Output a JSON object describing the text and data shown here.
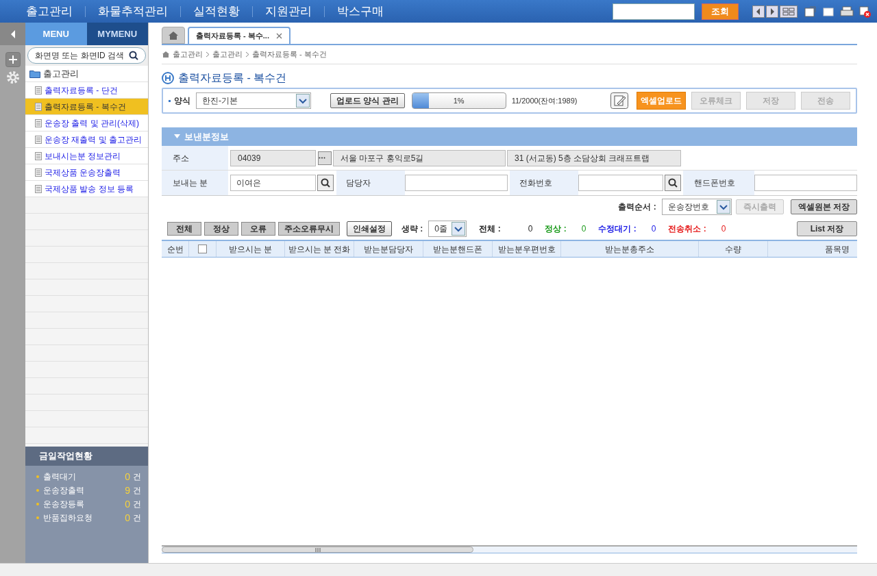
{
  "top_menu": [
    "출고관리",
    "화물추적관리",
    "실적현황",
    "지원관리",
    "박스구매"
  ],
  "top_search": {
    "button": "조회"
  },
  "side_tabs": [
    {
      "label": "MENU",
      "selected": true
    },
    {
      "label": "MYMENU",
      "selected": false
    }
  ],
  "side_search": {
    "placeholder": "화면명 또는 화면ID 검색"
  },
  "tree": {
    "label": "출고관리",
    "children": [
      {
        "label": "출력자료등록 - 단건",
        "selected": false
      },
      {
        "label": "출력자료등록 - 복수건",
        "selected": true
      },
      {
        "label": "운송장 출력 및 관리(삭제)",
        "selected": false
      },
      {
        "label": "운송장 재출력 및 출고관리",
        "selected": false
      },
      {
        "label": "보내시는분 정보관리",
        "selected": false
      },
      {
        "label": "국제상품 운송장출력",
        "selected": false
      },
      {
        "label": "국제상품 발송 정보 등록",
        "selected": false
      }
    ]
  },
  "today_status": {
    "title": "금일작업현황",
    "items": [
      {
        "label": "출력대기",
        "count": "0",
        "unit": "건"
      },
      {
        "label": "운송장출력",
        "count": "9",
        "unit": "건"
      },
      {
        "label": "운송장등록",
        "count": "0",
        "unit": "건"
      },
      {
        "label": "반품집하요청",
        "count": "0",
        "unit": "건"
      }
    ]
  },
  "tabs": [
    {
      "label": "출력자료등록 - 복수...",
      "selected": true
    }
  ],
  "breadcrumb": [
    "출고관리",
    "출고관리",
    "출력자료등록 - 복수건"
  ],
  "page_title": "출력자료등록 - 복수건",
  "toolbar": {
    "form_label": "양식",
    "form_value": "한진-기본",
    "manage_button": "업로드 양식 관리",
    "progress": {
      "level": 0.01,
      "reading": "1%"
    },
    "count": "11/2000(잔여:1989)",
    "buttons": [
      {
        "label": "엑셀업로드",
        "disabled": false
      },
      {
        "label": "오류체크",
        "disabled": true
      },
      {
        "label": "저장",
        "disabled": true
      },
      {
        "label": "전송",
        "disabled": true
      }
    ]
  },
  "sender": {
    "title": "보낸분정보",
    "address_label": "주소",
    "zip": "04039",
    "address1": "서울 마포구  홍익로5길",
    "address2": "31 (서교동) 5층 소담상회 크래프트랩",
    "name_label": "보내는 분",
    "name": "이여은",
    "contact_label": "담당자",
    "phone_label": "전화번호",
    "mobile_label": "핸드폰번호"
  },
  "output": {
    "order_label": "출력순서 :",
    "order_value": "운송장번호",
    "buttons": [
      {
        "label": "즉시출력",
        "disabled": true
      },
      {
        "label": "엑셀원본 저장",
        "disabled": false
      }
    ]
  },
  "filters": {
    "buttons": [
      "전체",
      "정상",
      "오류",
      "주소오류무시"
    ],
    "print_settings": "인쇄설정",
    "skip_label": "생략 :",
    "skip_value": "0줄",
    "summary": [
      {
        "label": "전체 :",
        "value": "0",
        "color": "#222222"
      },
      {
        "label": "정상 :",
        "value": "0",
        "color": "#1a9a1a"
      },
      {
        "label": "수정대기 :",
        "value": "0",
        "color": "#1a1ae6"
      },
      {
        "label": "전송취소 :",
        "value": "0",
        "color": "#e61a1a"
      }
    ],
    "list_save": "List 저장"
  },
  "table": {
    "columns": [
      {
        "kind": "text",
        "label": "순번"
      },
      {
        "kind": "checkbox",
        "checked": false
      },
      {
        "kind": "text",
        "label": "받으시는 분"
      },
      {
        "kind": "text",
        "label": "받으시는 분 전화"
      },
      {
        "kind": "text",
        "label": "받는분담당자"
      },
      {
        "kind": "text",
        "label": "받는분핸드폰"
      },
      {
        "kind": "text",
        "label": "받는분우편번호"
      },
      {
        "kind": "text",
        "label": "받는분총주소"
      },
      {
        "kind": "text",
        "label": "수량"
      },
      {
        "kind": "text",
        "label": "품목명"
      }
    ]
  }
}
